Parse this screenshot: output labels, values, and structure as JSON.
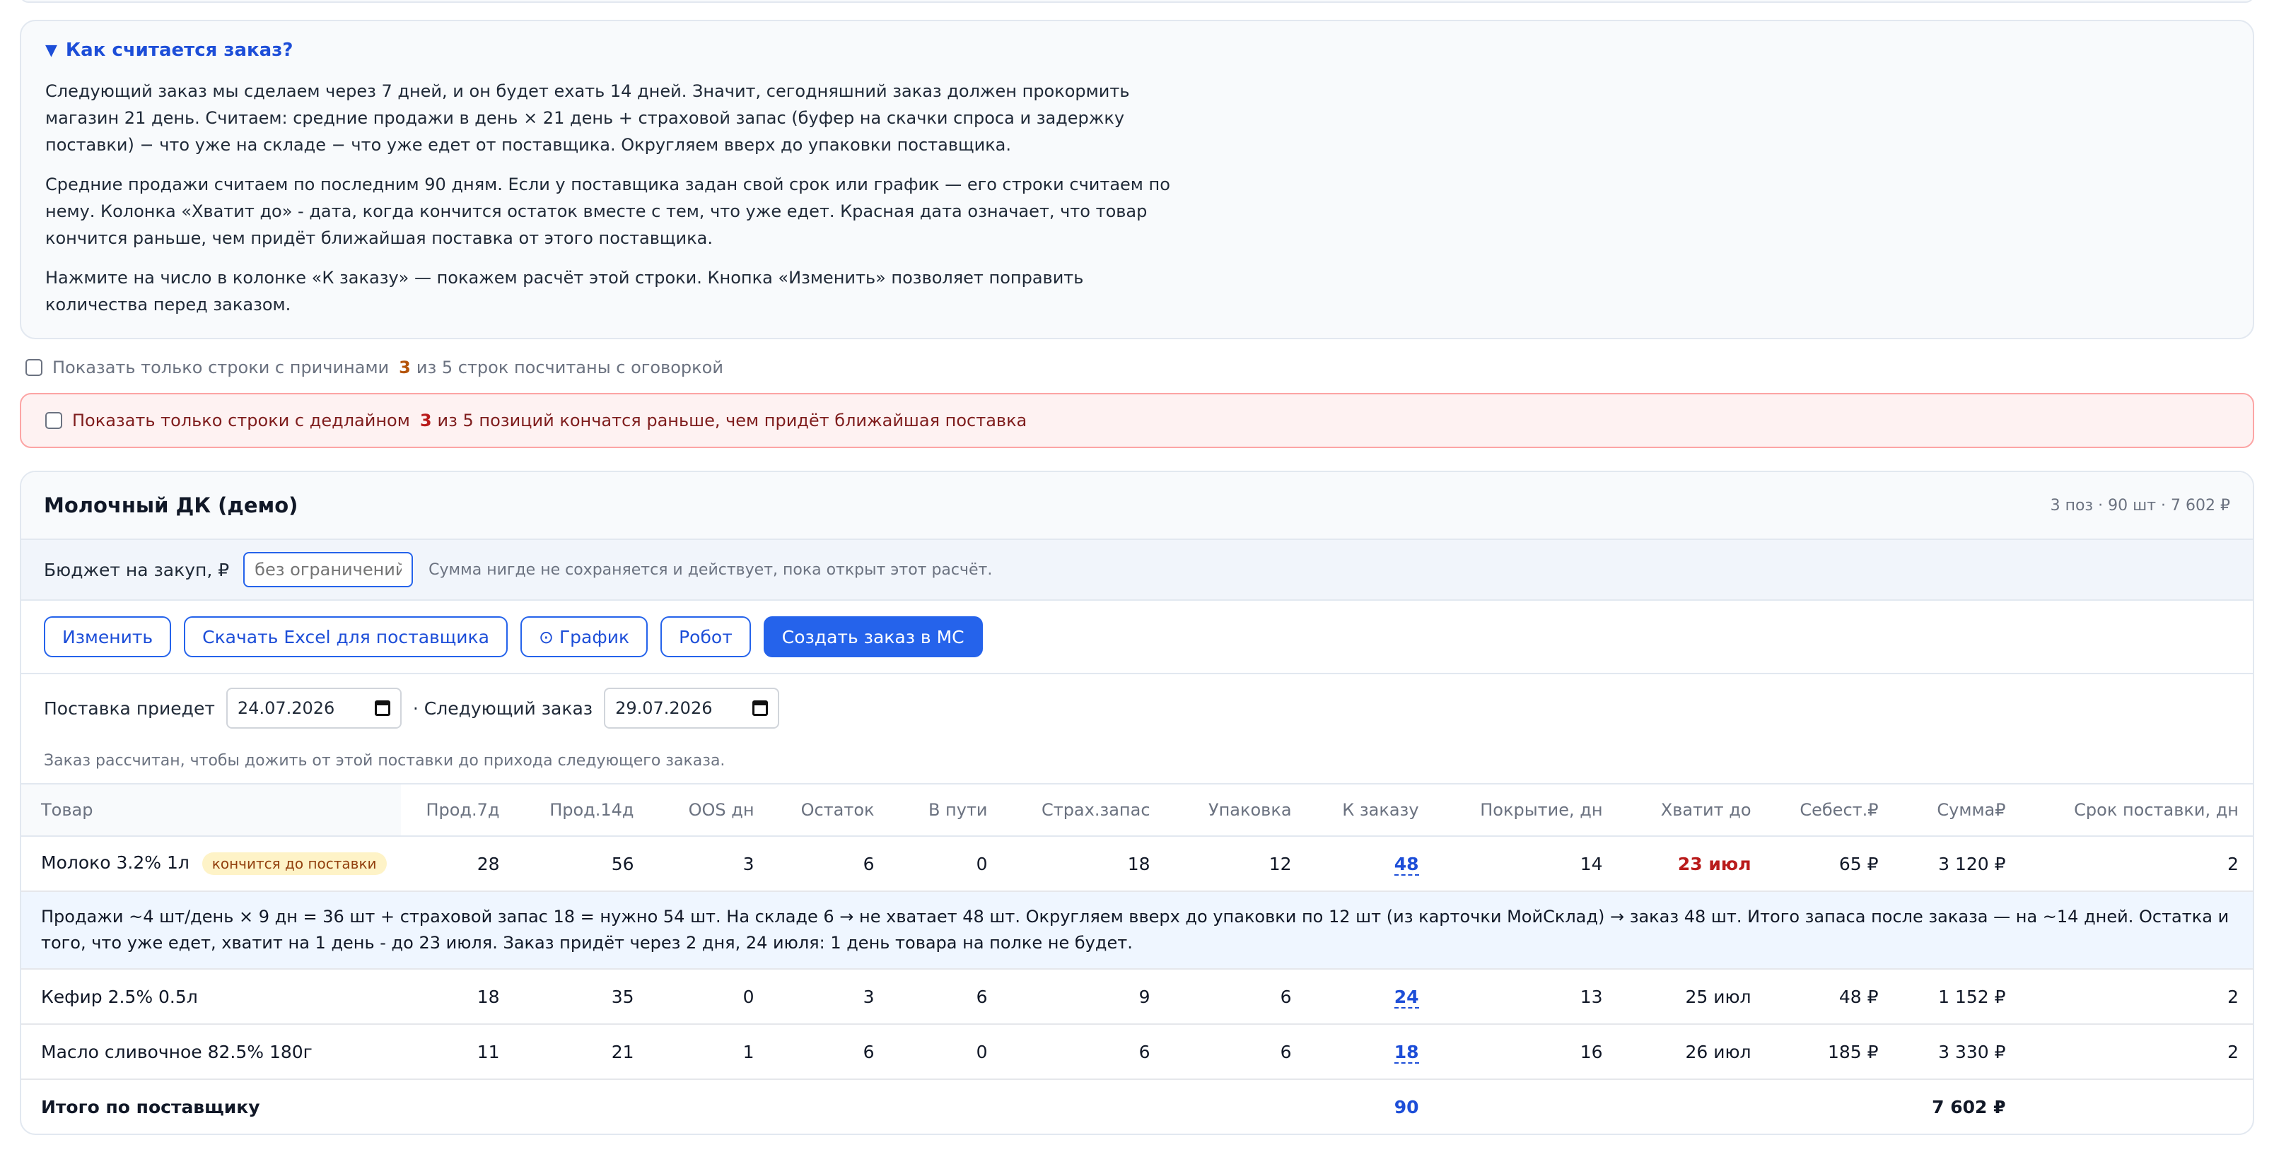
{
  "info": {
    "title": "Как считается заказ?",
    "paragraphs": [
      "Следующий заказ мы сделаем через 7 дней, и он будет ехать 14 дней. Значит, сегодняшний заказ должен прокормить магазин 21 день. Считаем: средние продажи в день × 21 день + страховой запас (буфер на скачки спроса и задержку поставки) − что уже на складе − что уже едет от поставщика. Округляем вверх до упаковки поставщика.",
      "Средние продажи считаем по последним 90 дням. Если у поставщика задан свой срок или график — его строки считаем по нему. Колонка «Хватит до» - дата, когда кончится остаток вместе с тем, что уже едет. Красная дата означает, что товар кончится раньше, чем придёт ближайшая поставка от этого поставщика.",
      "Нажмите на число в колонке «К заказу» — покажем расчёт этой строки. Кнопка «Изменить» позволяет поправить количества перед заказом."
    ]
  },
  "filters": {
    "reasons_label": "Показать только строки с причинами",
    "reasons_count": "3",
    "reasons_text": "из 5 строк посчитаны с оговоркой",
    "deadline_label": "Показать только строки с дедлайном",
    "deadline_count": "3",
    "deadline_text": "из 5 позиций кончатся раньше, чем придёт ближайшая поставка"
  },
  "supplier": {
    "name": "Молочный ДК (демо)",
    "meta": "3 поз · 90 шт · 7 602 ₽",
    "budget_label": "Бюджет на закуп, ₽",
    "budget_placeholder": "без ограничений",
    "budget_hint": "Сумма нигде не сохраняется и действует, пока открыт этот расчёт.",
    "buttons": {
      "edit": "Изменить",
      "excel": "Скачать Excel для поставщика",
      "schedule_icon": "⊙",
      "schedule": "График",
      "robot": "Робот",
      "create": "Создать заказ в МС"
    },
    "arrival_label": "Поставка приедет",
    "arrival_date": "24.07.2026",
    "next_label": "· Следующий заказ",
    "next_date": "29.07.2026",
    "calc_note": "Заказ рассчитан, чтобы дожить от этой поставки до прихода следующего заказа."
  },
  "table": {
    "headers": [
      "Товар",
      "Прод.7д",
      "Прод.14д",
      "OOS дн",
      "Остаток",
      "В пути",
      "Страх.запас",
      "Упаковка",
      "К заказу",
      "Покрытие, дн",
      "Хватит до",
      "Себест.₽",
      "Сумма₽",
      "Срок поставки, дн"
    ],
    "rows": [
      {
        "name": "Молоко 3.2% 1л",
        "badge": "кончится до поставки",
        "s7": "28",
        "s14": "56",
        "oos": "3",
        "stock": "6",
        "transit": "0",
        "safety": "18",
        "pack": "12",
        "order": "48",
        "cover": "14",
        "until": "23 июл",
        "cost": "65 ₽",
        "sum": "3 120 ₽",
        "lead": "2"
      },
      {
        "name": "Кефир 2.5% 0.5л",
        "s7": "18",
        "s14": "35",
        "oos": "0",
        "stock": "3",
        "transit": "6",
        "safety": "9",
        "pack": "6",
        "order": "24",
        "cover": "13",
        "until": "25 июл",
        "cost": "48 ₽",
        "sum": "1 152 ₽",
        "lead": "2"
      },
      {
        "name": "Масло сливочное 82.5% 180г",
        "s7": "11",
        "s14": "21",
        "oos": "1",
        "stock": "6",
        "transit": "0",
        "safety": "6",
        "pack": "6",
        "order": "18",
        "cover": "16",
        "until": "26 июл",
        "cost": "185 ₽",
        "sum": "3 330 ₽",
        "lead": "2"
      }
    ],
    "explain": "Продажи ~4 шт/день × 9 дн = 36 шт + страховой запас 18 = нужно 54 шт. На складе 6 → не хватает 48 шт. Округляем вверх до упаковки по 12 шт (из карточки МойСклад) → заказ 48 шт. Итого запаса после заказа — на ~14 дней. Остатка и того, что уже едет, хватит на 1 день - до 23 июля. Заказ придёт через 2 дня, 24 июля: 1 день товара на полке не будет.",
    "total_label": "Итого по поставщику",
    "total_order": "90",
    "total_sum": "7 602 ₽"
  }
}
